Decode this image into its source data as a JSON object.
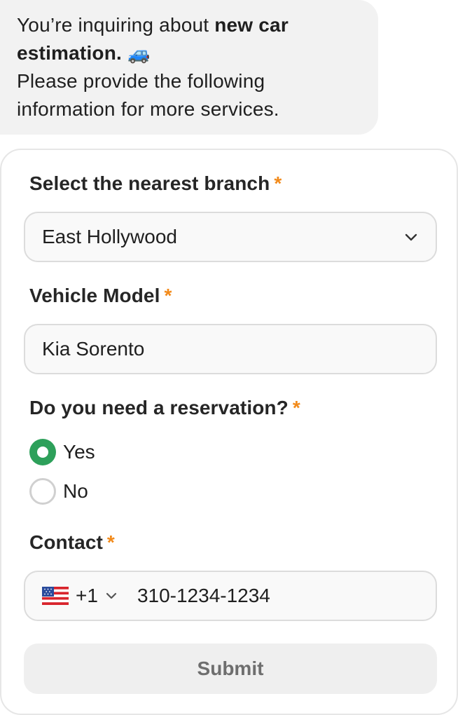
{
  "message": {
    "line1_prefix": "You’re inquiring about ",
    "line1_bold": "new car",
    "line2_bold": "estimation.",
    "emoji": "🚙",
    "line3": "Please provide the following",
    "line4": "information for more services."
  },
  "form": {
    "required_mark": "*",
    "branch": {
      "label": "Select the nearest branch",
      "value": "East Hollywood"
    },
    "vehicle": {
      "label": "Vehicle Model",
      "value": "Kia Sorento"
    },
    "reservation": {
      "label": "Do you need a reservation?",
      "options": [
        {
          "label": "Yes",
          "selected": true
        },
        {
          "label": "No",
          "selected": false
        }
      ]
    },
    "contact": {
      "label": "Contact",
      "country_flag": "flag-us-icon",
      "country_code": "+1",
      "value": "310-1234-1234"
    },
    "submit_label": "Submit"
  },
  "colors": {
    "accent_green": "#2da05a",
    "required_orange": "#f28a1a"
  }
}
